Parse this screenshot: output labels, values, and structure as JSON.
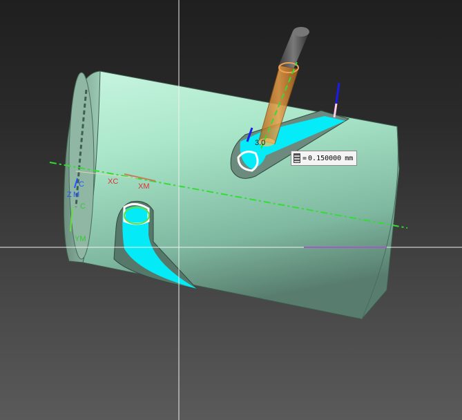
{
  "window": {
    "title": ""
  },
  "tooltip": {
    "prefix": "=",
    "value": "0.150000",
    "unit": "mm"
  },
  "labels": {
    "xc": "XC",
    "xm": "XM",
    "zc": "C",
    "zm": "ZM",
    "ym": "YM",
    "yc": "C",
    "tool_value": "3.0"
  },
  "colors": {
    "part_body": "#b8f0d6",
    "toolpath": "#00f0ff",
    "tool_holder": "#d98a2c",
    "tool_shank": "#555555",
    "axis_line": "#33dd33",
    "crosshair": "#ffffff"
  },
  "icons": [
    "tooltip-grid-icon"
  ]
}
